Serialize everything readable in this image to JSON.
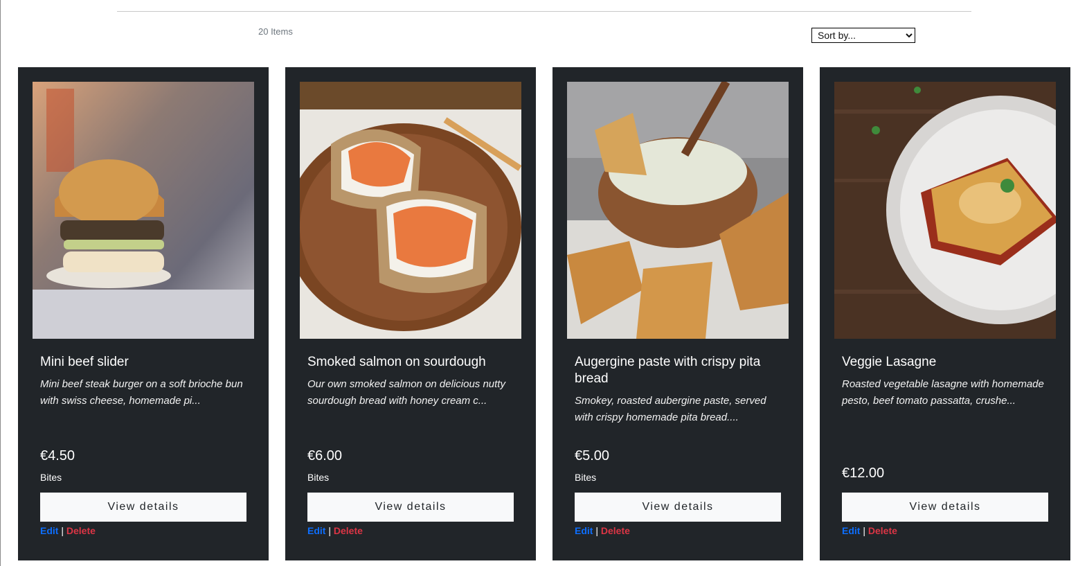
{
  "toolbar": {
    "item_count": "20 Items",
    "sort_selected": "Sort by...",
    "sort_options": [
      "Sort by..."
    ]
  },
  "products": [
    {
      "title": "Mini beef slider",
      "description": "Mini beef steak burger on a soft brioche bun with swiss cheese, homemade pi...",
      "price": "€4.50",
      "category": "Bites",
      "view_label": "View details",
      "edit_label": "Edit",
      "separator": "|",
      "delete_label": "Delete",
      "image_subject": "beef-slider-photo"
    },
    {
      "title": "Smoked salmon on sourdough",
      "description": "Our own smoked salmon on delicious nutty sourdough bread with honey cream c...",
      "price": "€6.00",
      "category": "Bites",
      "view_label": "View details",
      "edit_label": "Edit",
      "separator": "|",
      "delete_label": "Delete",
      "image_subject": "salmon-toast-photo"
    },
    {
      "title": "Augergine paste with crispy pita bread",
      "description": "Smokey, roasted aubergine paste, served with crispy homemade pita bread....",
      "price": "€5.00",
      "category": "Bites",
      "view_label": "View details",
      "edit_label": "Edit",
      "separator": "|",
      "delete_label": "Delete",
      "image_subject": "aubergine-dip-photo"
    },
    {
      "title": "Veggie Lasagne",
      "description": "Roasted vegetable lasagne with homemade pesto, beef tomato passatta, crushe...",
      "price": "€12.00",
      "category": "",
      "view_label": "View details",
      "edit_label": "Edit",
      "separator": "|",
      "delete_label": "Delete",
      "image_subject": "veggie-lasagne-photo"
    }
  ],
  "colors": {
    "card_bg": "#212529",
    "button_bg": "#f8f9fa",
    "edit_link": "#0d6efd",
    "delete_link": "#dc3545"
  }
}
